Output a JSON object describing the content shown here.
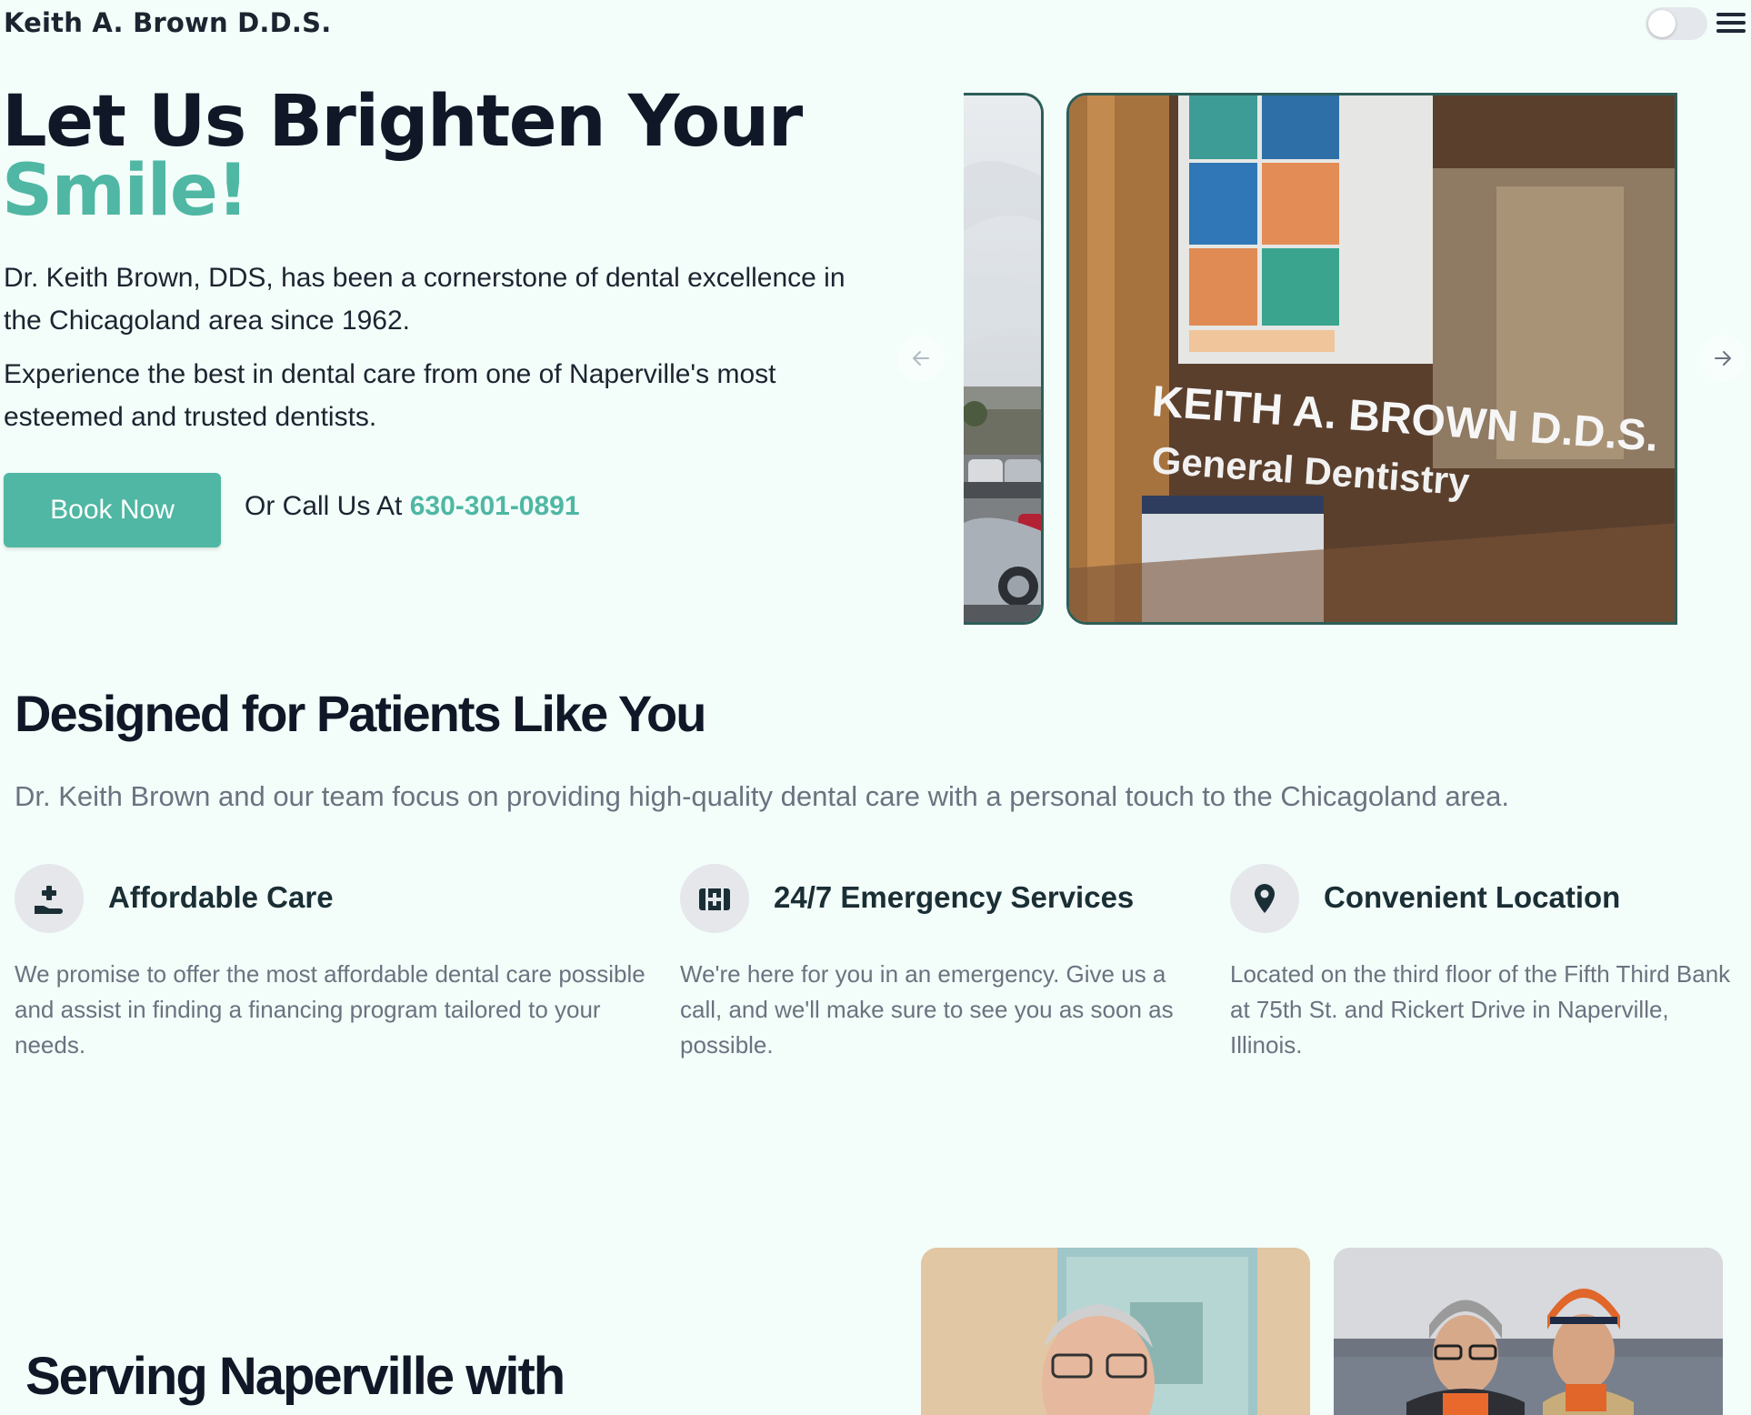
{
  "header": {
    "brand": "Keith A. Brown D.D.S.",
    "theme_toggle_state": "off",
    "menu_icon": "hamburger-icon"
  },
  "hero": {
    "title_line1": "Let Us Brighten Your",
    "title_line2": "Smile!",
    "paragraph1": "Dr. Keith Brown, DDS, has been a cornerstone of dental excellence in the Chicagoland area since 1962.",
    "paragraph2": "Experience the best in dental care from one of Naperville's most esteemed and trusted dentists.",
    "book_button": "Book Now",
    "call_prefix": "Or Call Us At",
    "phone": "630-301-0891"
  },
  "carousel": {
    "prev_icon": "arrow-left-icon",
    "next_icon": "arrow-right-icon",
    "slide_text_line1": "KEITH A. BROWN  D.D.S.",
    "slide_text_line2": "General Dentistry"
  },
  "features_section": {
    "title": "Designed for Patients Like You",
    "subtitle": "Dr. Keith Brown and our team focus on providing high-quality dental care with a personal touch to the Chicagoland area.",
    "items": [
      {
        "icon": "hand-plus-icon",
        "title": "Affordable Care",
        "description": "We promise to offer the most affordable dental care possible and assist in finding a financing program tailored to your needs."
      },
      {
        "icon": "medical-kit-icon",
        "title": "24/7 Emergency Services",
        "description": "We're here for you in an emergency. Give us a call, and we'll make sure to see you as soon as possible."
      },
      {
        "icon": "location-pin-icon",
        "title": "Convenient Location",
        "description": "Located on the third floor of the Fifth Third Bank at 75th St. and Rickert Drive in Naperville, Illinois."
      }
    ]
  },
  "serving_section": {
    "title": "Serving Naperville with"
  },
  "colors": {
    "background": "#f3fdf9",
    "accent": "#4fb7a3",
    "heading": "#101828",
    "muted": "#6b7280",
    "slide_border": "#2d5e58"
  }
}
